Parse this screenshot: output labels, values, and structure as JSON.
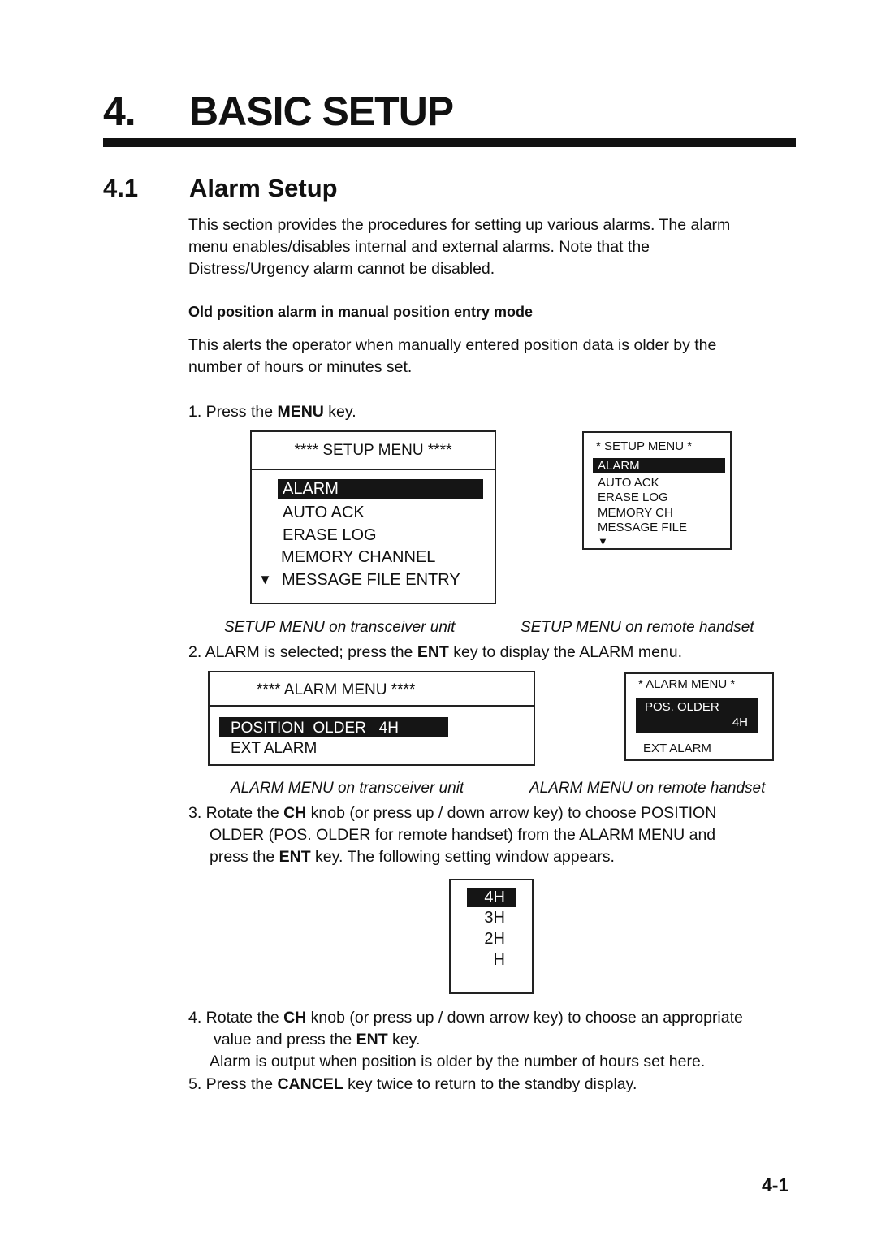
{
  "chapter": {
    "number": "4.",
    "title": "BASIC SETUP"
  },
  "section": {
    "number": "4.1",
    "title": "Alarm Setup"
  },
  "intro": [
    "This section provides the procedures for setting up various alarms. The alarm",
    "menu enables/disables internal and external alarms. Note that the",
    "Distress/Urgency alarm cannot be disabled."
  ],
  "subheading": "Old position alarm in manual position entry mode",
  "subintro": [
    "This alerts the operator when manually entered position data is older by the",
    "number of hours or minutes set."
  ],
  "steps": {
    "s1": {
      "pre": "1. Press the ",
      "key": "MENU",
      "post": " key."
    },
    "s2": {
      "pre": "2. ALARM is selected; press the ",
      "key": "ENT",
      "post": " key to display the ALARM menu."
    },
    "s3": {
      "l1_pre": "3. Rotate the ",
      "l1_key": "CH",
      "l1_post": " knob (or press up / down arrow key) to choose POSITION",
      "l2": "OLDER (POS. OLDER for remote handset) from the ALARM MENU and",
      "l3_pre": "press the ",
      "l3_key": "ENT",
      "l3_post": " key. The following setting window appears."
    },
    "s4": {
      "l1_pre": "4. Rotate the ",
      "l1_key": "CH",
      "l1_post": " knob (or press up / down arrow key) to choose an appropriate",
      "l2_pre": "value and press the ",
      "l2_key": "ENT",
      "l2_post": " key.",
      "l3": "Alarm is output when position is older by the number of hours set here."
    },
    "s5": {
      "pre": "5. Press the ",
      "key": "CANCEL",
      "post": " key twice to return to the standby display."
    }
  },
  "setup_menu_unit": {
    "title": "**** SETUP MENU ****",
    "items": [
      "ALARM",
      "AUTO  ACK",
      "ERASE  LOG",
      "MEMORY CHANNEL",
      "MESSAGE FILE ENTRY"
    ],
    "selected": "ALARM",
    "more_icon": "▼",
    "caption": "SETUP MENU on transceiver unit"
  },
  "setup_menu_handset": {
    "title": "* SETUP MENU *",
    "items": [
      "ALARM",
      "AUTO  ACK",
      "ERASE  LOG",
      "MEMORY CH",
      "MESSAGE FILE"
    ],
    "more_icon": "▼",
    "caption": "SETUP MENU on remote handset"
  },
  "alarm_menu_unit": {
    "title": "**** ALARM MENU ****",
    "items": [
      "POSITION  OLDER   4H",
      "EXT ALARM"
    ],
    "caption": "ALARM MENU on transceiver unit"
  },
  "alarm_menu_handset": {
    "title": "* ALARM MENU *",
    "selected_line1": "POS. OLDER",
    "selected_line2": "4H",
    "items": [
      "EXT ALARM"
    ],
    "caption": "ALARM MENU on remote handset"
  },
  "hour_options": [
    "4H",
    "3H",
    "2H",
    "H"
  ],
  "page_number": "4-1"
}
